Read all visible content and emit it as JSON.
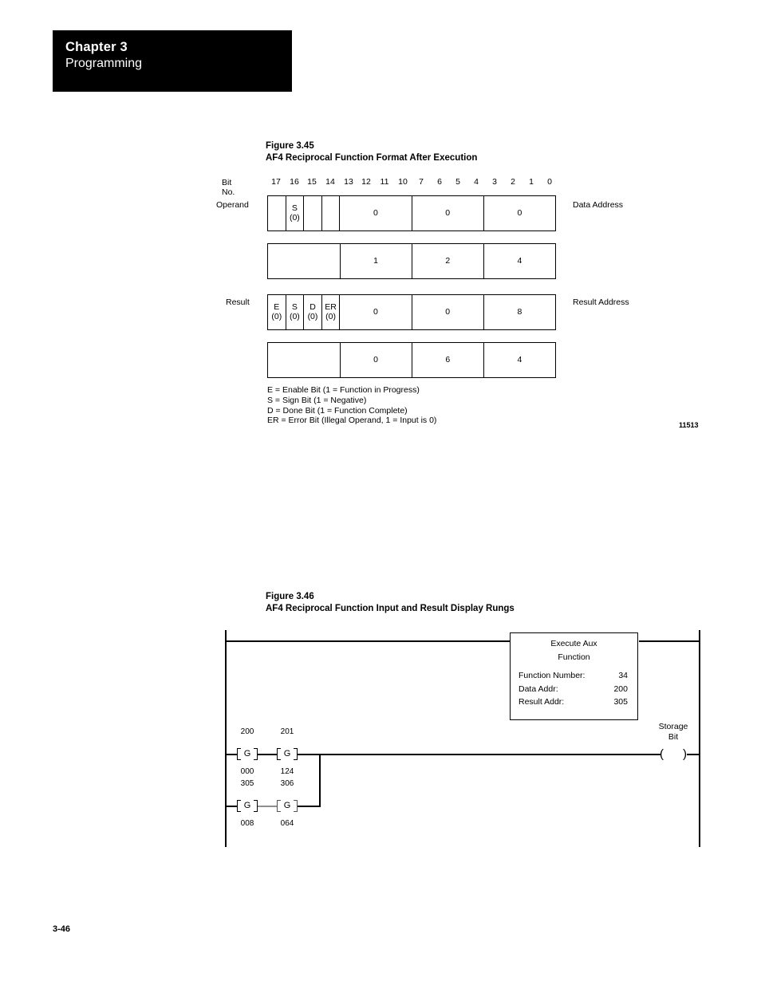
{
  "header": {
    "chapter": "Chapter 3",
    "section": "Programming"
  },
  "figure345": {
    "caption_line1": "Figure 3.45",
    "caption_line2": "AF4 Reciprocal Function Format After Execution",
    "bit_no_label": "Bit No.",
    "bit_numbers": [
      "17",
      "16",
      "15",
      "14",
      "13",
      "12",
      "11",
      "10",
      "7",
      "6",
      "5",
      "4",
      "3",
      "2",
      "1",
      "0"
    ],
    "operand_label": "Operand",
    "result_label": "Result",
    "data_address_label": "Data Address",
    "result_address_label": "Result Address",
    "drawing_number": "11513",
    "operand_row1": {
      "bits": [
        {
          "name": "",
          "value": ""
        },
        {
          "name": "S",
          "value": "(0)"
        },
        {
          "name": "",
          "value": ""
        },
        {
          "name": "",
          "value": ""
        }
      ],
      "digits": [
        "0",
        "0",
        "0"
      ]
    },
    "operand_row2": {
      "blank": "",
      "digits": [
        "1",
        "2",
        "4"
      ]
    },
    "result_row1": {
      "bits": [
        {
          "name": "E",
          "value": "(0)"
        },
        {
          "name": "S",
          "value": "(0)"
        },
        {
          "name": "D",
          "value": "(0)"
        },
        {
          "name": "ER",
          "value": "(0)"
        }
      ],
      "digits": [
        "0",
        "0",
        "8"
      ]
    },
    "result_row2": {
      "blank": "",
      "digits": [
        "0",
        "6",
        "4"
      ]
    },
    "legend": [
      "E = Enable Bit (1 = Function in Progress)",
      "S = Sign Bit (1 = Negative)",
      "D = Done Bit (1 = Function Complete)",
      "ER = Error Bit (Illegal Operand, 1 = Input is 0)"
    ]
  },
  "figure346": {
    "caption_line1": "Figure 3.46",
    "caption_line2": "AF4 Reciprocal Function Input and Result Display Rungs",
    "function_block": {
      "title_line1": "Execute Aux",
      "title_line2": "Function",
      "rows": [
        {
          "label": "Function Number:",
          "value": "34"
        },
        {
          "label": "Data Addr:",
          "value": "200"
        },
        {
          "label": "Result Addr:",
          "value": "305"
        }
      ]
    },
    "contacts": [
      {
        "top_addr": "200",
        "bottom_addr": "000",
        "symbol": "G"
      },
      {
        "top_addr": "201",
        "bottom_addr": "124",
        "symbol": "G"
      },
      {
        "top_addr": "305",
        "bottom_addr": "008",
        "symbol": "G"
      },
      {
        "top_addr": "306",
        "bottom_addr": "064",
        "symbol": "G"
      }
    ],
    "coil": {
      "label_line1": "Storage",
      "label_line2": "Bit",
      "left_paren": "(",
      "right_paren": ")"
    }
  },
  "footer": {
    "page_number": "3-46"
  }
}
